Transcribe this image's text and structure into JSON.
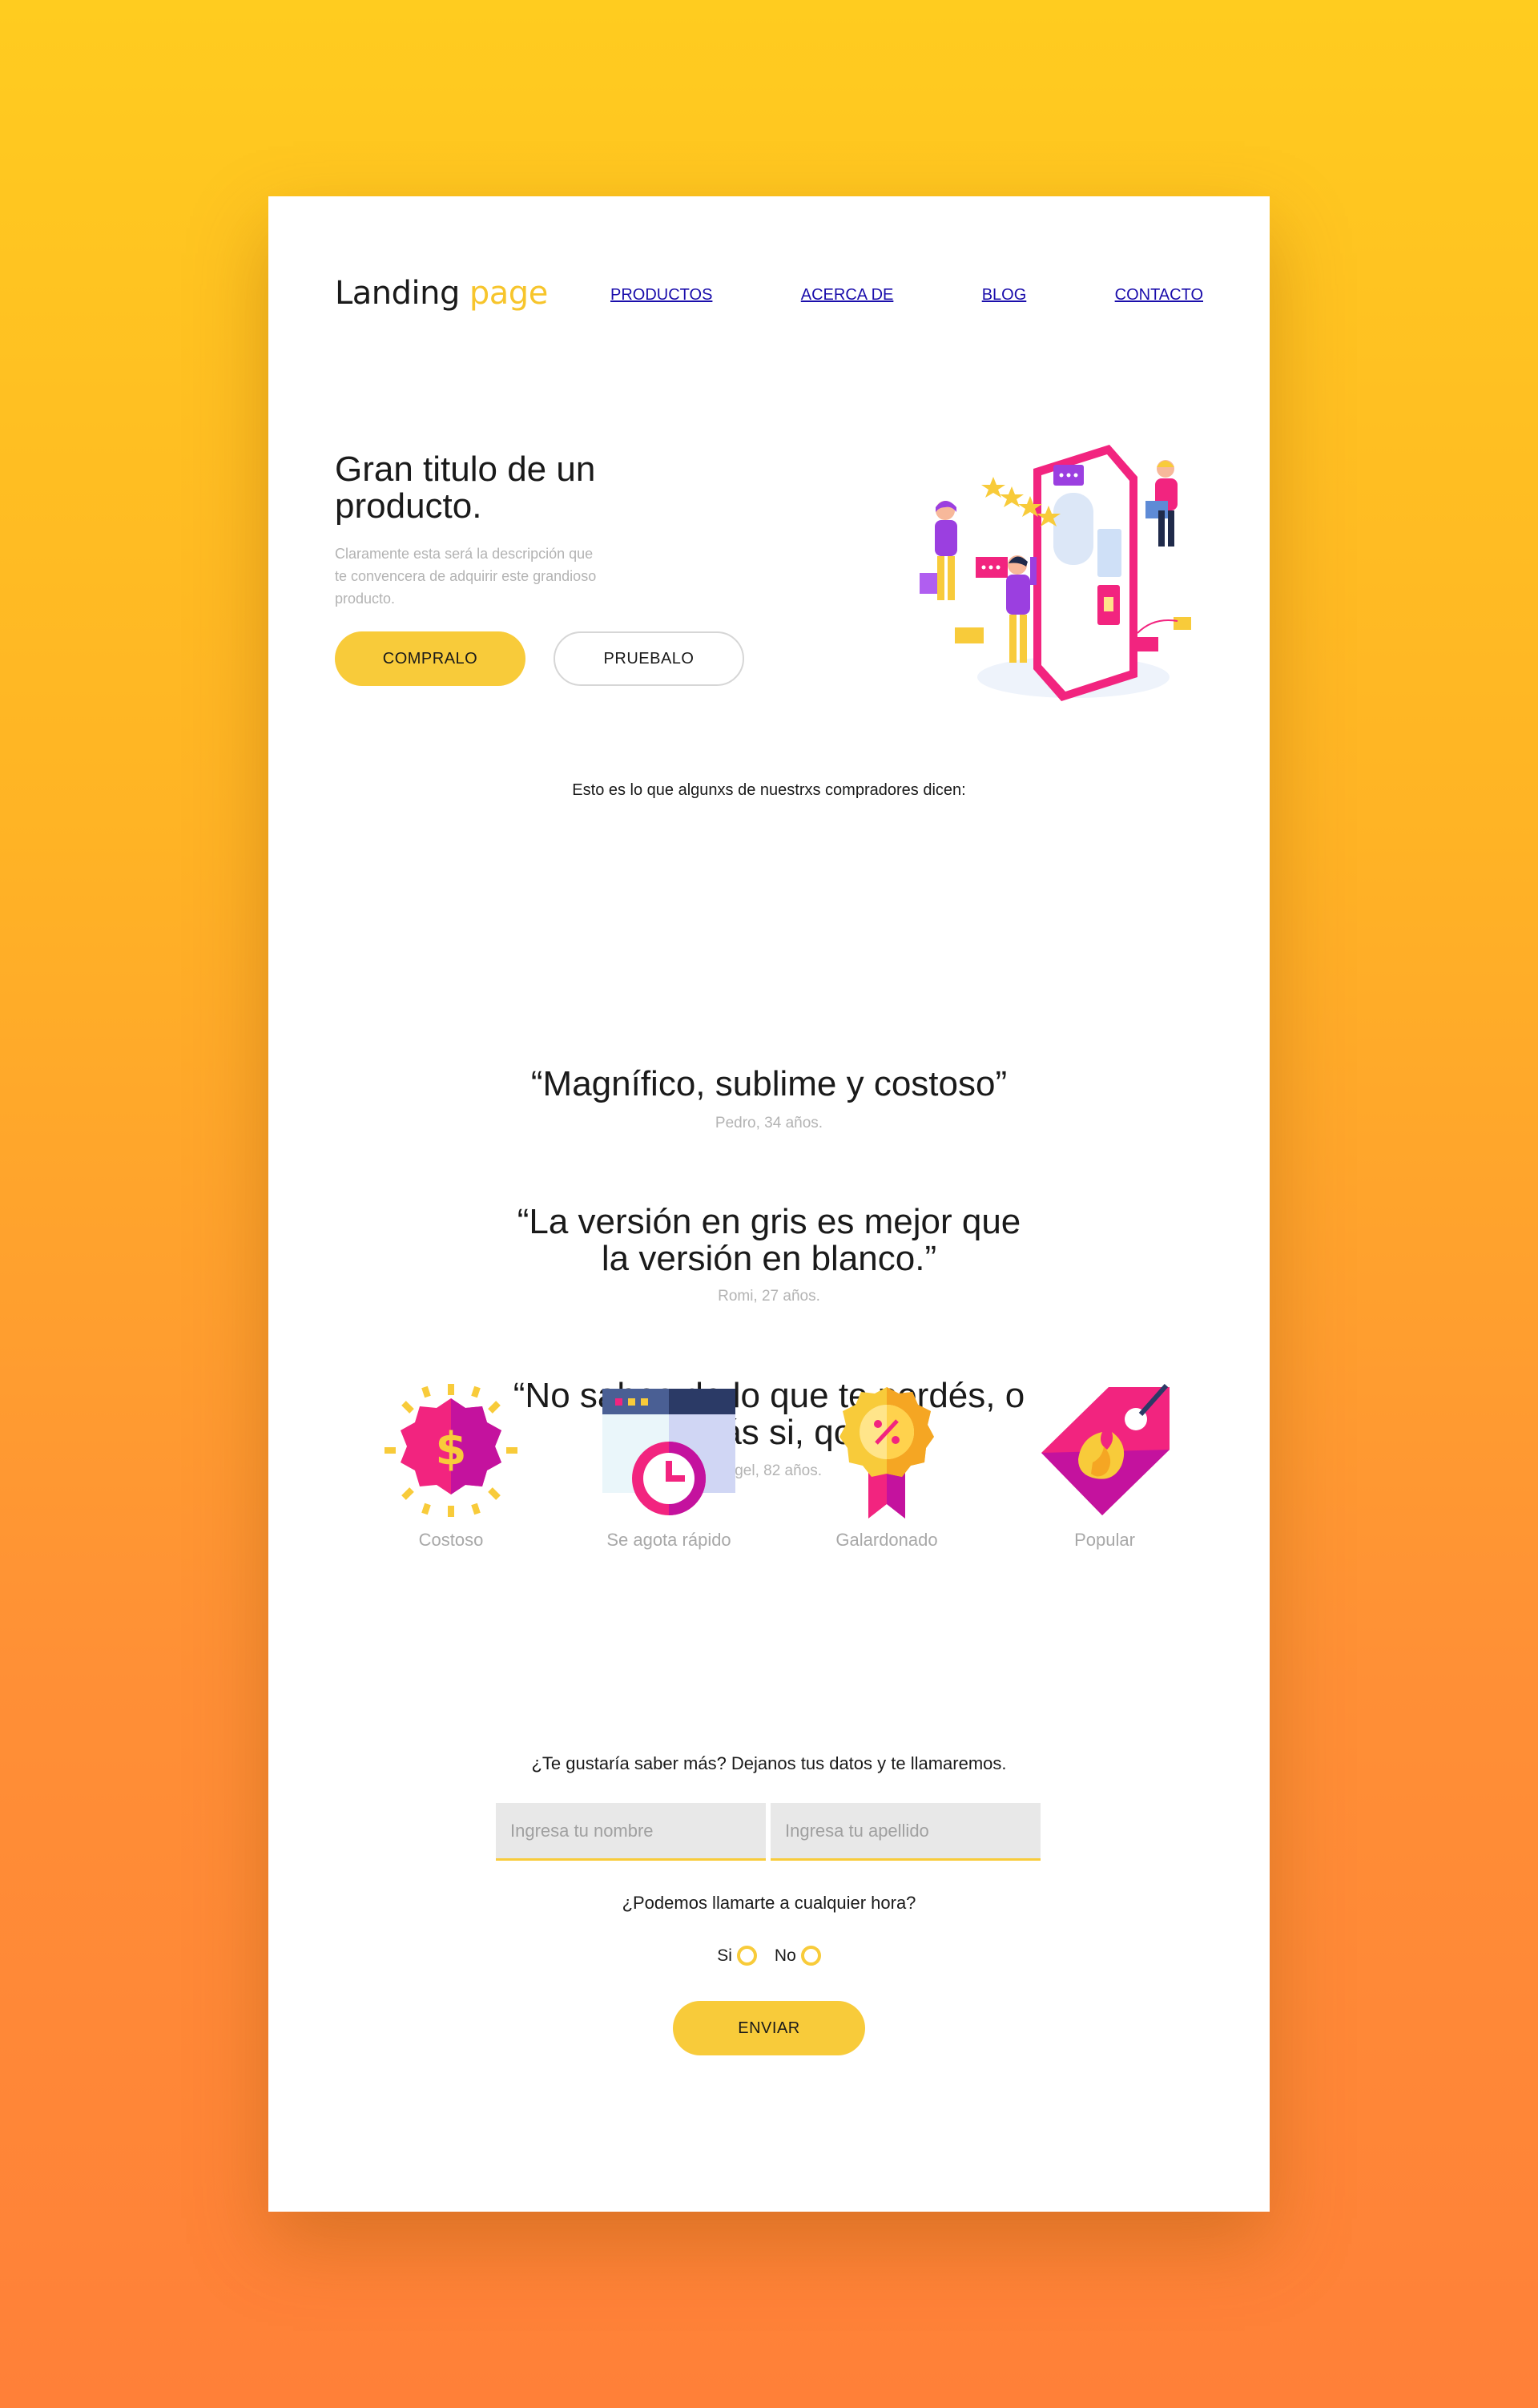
{
  "logo": {
    "part1": "Landing",
    "part2": "page"
  },
  "nav": {
    "items": [
      "PRODUCTOS",
      "ACERCA DE",
      "BLOG",
      "CONTACTO"
    ]
  },
  "hero": {
    "title": "Gran titulo de un producto.",
    "description": "Claramente esta será la descripción que te convencera de adquirir este grandioso producto.",
    "buy_label": "COMPRALO",
    "try_label": "PRUEBALO"
  },
  "testimonials": {
    "intro": "Esto es lo que algunxs de nuestrxs compradores dicen:",
    "items": [
      {
        "quote": "“Magnífico, sublime y costoso”",
        "author": "Pedro, 34 años."
      },
      {
        "quote": "“La versión en gris es mejor que la versión en blanco.”",
        "author": "Romi, 27 años."
      },
      {
        "quote": "“No sabes de lo que te perdés, o quizás si, qcy”",
        "author": "Angel, 82 años."
      }
    ]
  },
  "features": [
    {
      "label": "Costoso",
      "icon": "dollar-badge-icon"
    },
    {
      "label": "Se agota rápido",
      "icon": "browser-clock-icon"
    },
    {
      "label": "Galardonado",
      "icon": "award-ribbon-icon"
    },
    {
      "label": "Popular",
      "icon": "fire-tag-icon"
    }
  ],
  "form": {
    "intro": "¿Te gustaría saber más? Dejanos tus datos y te llamaremos.",
    "first_name_placeholder": "Ingresa tu nombre",
    "last_name_placeholder": "Ingresa tu apellido",
    "call_question": "¿Podemos llamarte a cualquier hora?",
    "yes_label": "Si",
    "no_label": "No",
    "submit_label": "ENVIAR"
  },
  "colors": {
    "accent": "#f8cb3a",
    "pink": "#f2247f",
    "purple": "#9b3fe0",
    "link": "#1a0dab",
    "background_top": "#ffcc1f",
    "background_bottom": "#ff8038"
  }
}
